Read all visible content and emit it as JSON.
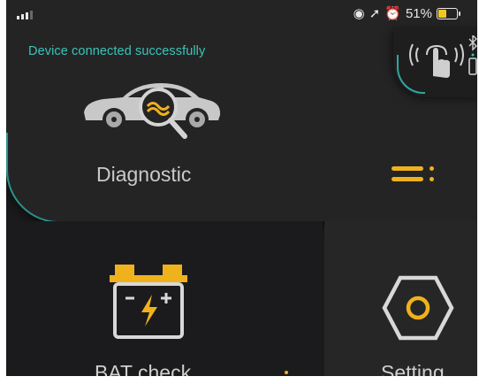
{
  "status_bar": {
    "battery_percent": "51%",
    "battery_level": 0.51
  },
  "banner": {
    "message": "Device connected successfully"
  },
  "diagnostic": {
    "label": "Diagnostic"
  },
  "tiles": {
    "battery_check": {
      "label": "BAT check"
    },
    "setting": {
      "label": "Setting"
    }
  },
  "colors": {
    "accent": "#f0b21c",
    "teal": "#38c4ba",
    "background": "#1b1b1d"
  },
  "icons": [
    "signal-icon",
    "location-icon",
    "arrow-icon",
    "alarm-icon",
    "battery-icon",
    "nfc-touch-icon",
    "bluetooth-icon",
    "phone-icon",
    "car-diagnostic-icon",
    "menu-icon",
    "car-battery-icon",
    "hex-nut-icon"
  ]
}
